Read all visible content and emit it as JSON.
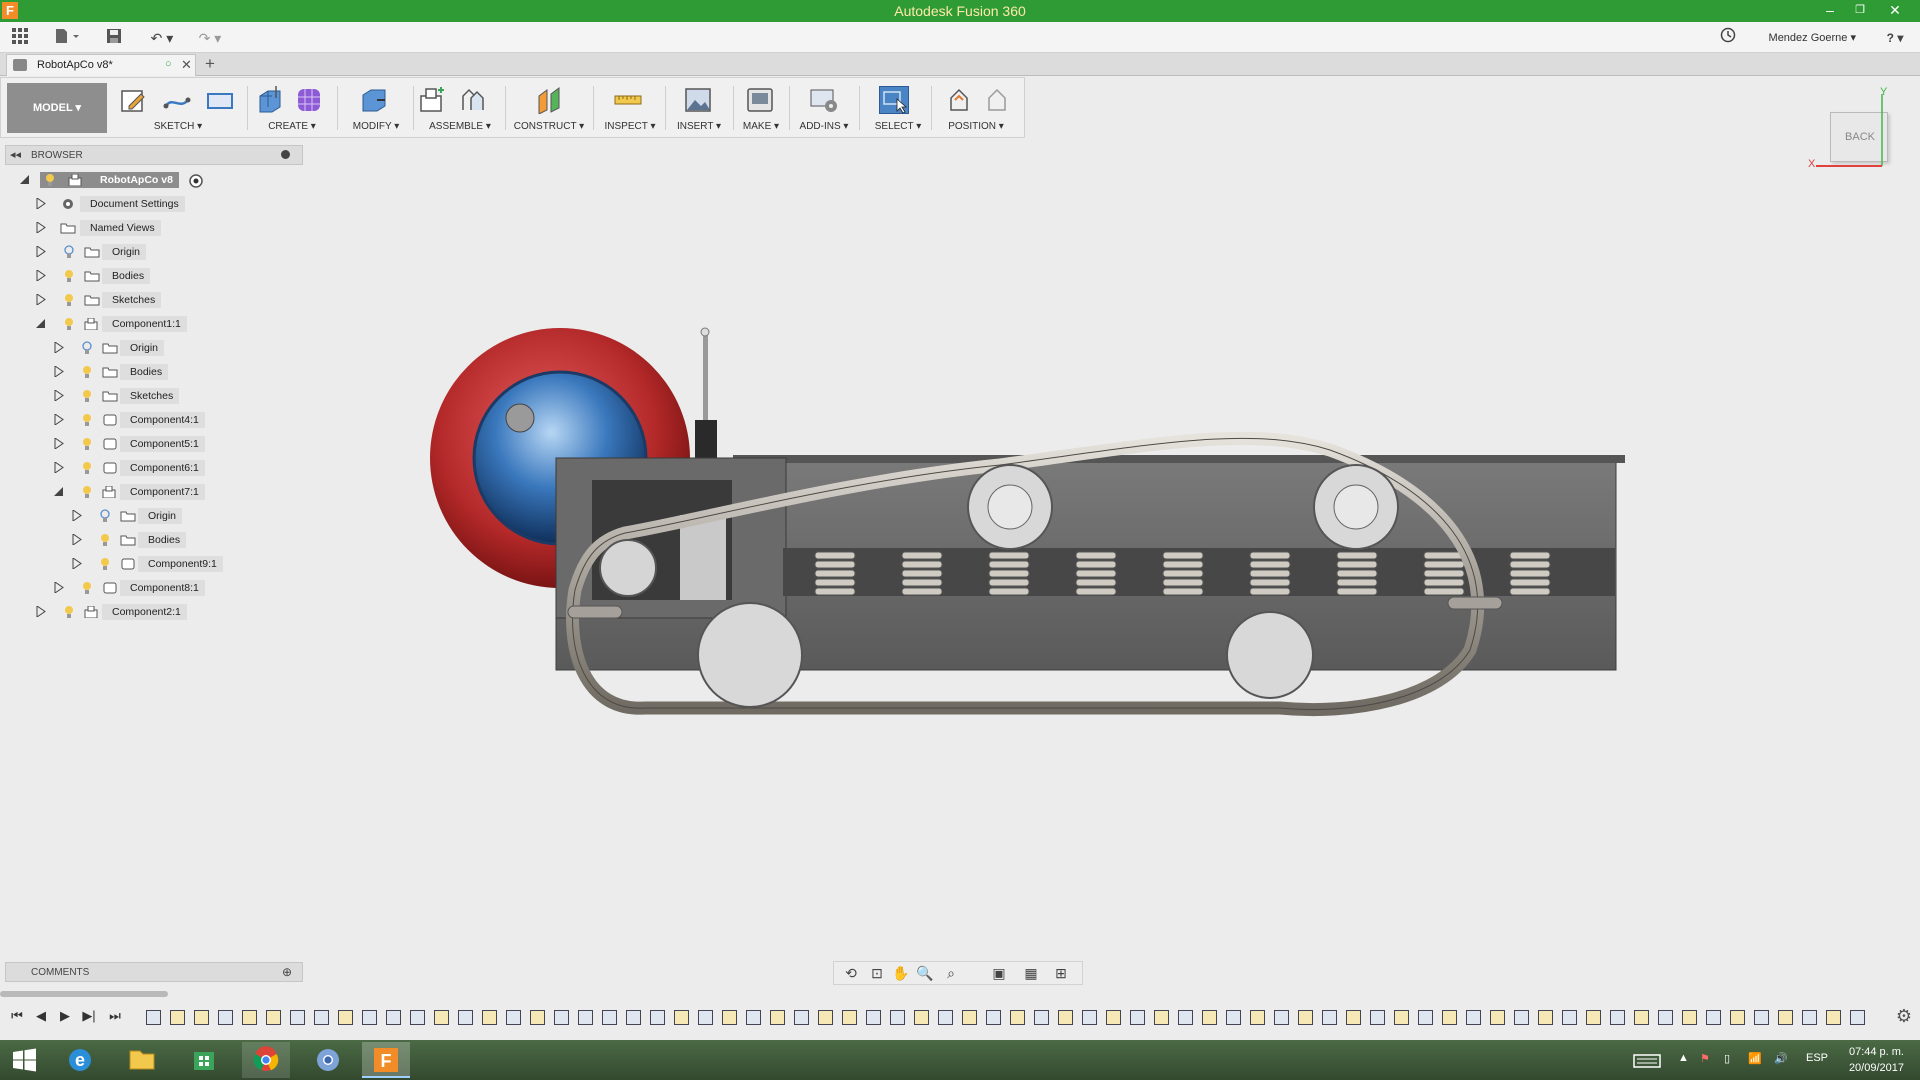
{
  "window": {
    "title": "Autodesk Fusion 360",
    "minimize": "–",
    "restore": "❐",
    "close": "✕"
  },
  "qat": {
    "user_name": "Mendez Goerne ▾",
    "help": "? ▾",
    "undo": "↶ ▾",
    "redo": "↷ ▾"
  },
  "tabs": [
    {
      "label": "RobotApCo v8*",
      "close": "✕"
    }
  ],
  "toolbar": {
    "workspace_label": "MODEL ▾",
    "groups": [
      {
        "label": "SKETCH ▾"
      },
      {
        "label": "CREATE ▾"
      },
      {
        "label": "MODIFY ▾"
      },
      {
        "label": "ASSEMBLE ▾"
      },
      {
        "label": "CONSTRUCT ▾"
      },
      {
        "label": "INSPECT ▾"
      },
      {
        "label": "INSERT ▾"
      },
      {
        "label": "MAKE ▾"
      },
      {
        "label": "ADD-INS ▾"
      },
      {
        "label": "SELECT ▾"
      },
      {
        "label": "POSITION ▾"
      }
    ]
  },
  "browser": {
    "title": "BROWSER",
    "nodes": [
      {
        "label": "RobotApCo v8"
      },
      {
        "label": "Document Settings"
      },
      {
        "label": "Named Views"
      },
      {
        "label": "Origin"
      },
      {
        "label": "Bodies"
      },
      {
        "label": "Sketches"
      },
      {
        "label": "Component1:1"
      },
      {
        "label": "Origin"
      },
      {
        "label": "Bodies"
      },
      {
        "label": "Sketches"
      },
      {
        "label": "Component4:1"
      },
      {
        "label": "Component5:1"
      },
      {
        "label": "Component6:1"
      },
      {
        "label": "Component7:1"
      },
      {
        "label": "Origin"
      },
      {
        "label": "Bodies"
      },
      {
        "label": "Component9:1"
      },
      {
        "label": "Component8:1"
      },
      {
        "label": "Component2:1"
      }
    ]
  },
  "viewcube": {
    "face": "BACK",
    "axis_x": "X",
    "axis_y": "Y"
  },
  "comments": {
    "title": "COMMENTS",
    "add": "⊕"
  },
  "taskbar": {
    "language": "ESP",
    "time": "07:44 p. m.",
    "date": "20/09/2017"
  }
}
